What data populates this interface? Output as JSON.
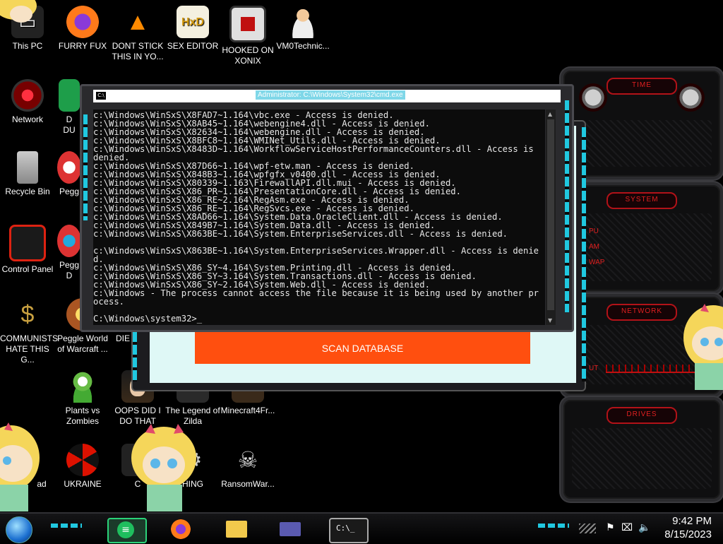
{
  "desktop": {
    "icons": [
      {
        "label": "This PC"
      },
      {
        "label": "FURRY FUX"
      },
      {
        "label": "DONT STICK\nTHIS IN YO..."
      },
      {
        "label": "SEX EDITOR"
      },
      {
        "label": "HOOKED ON\nXONIX"
      },
      {
        "label": "VM0Technic..."
      },
      {
        "label": "Network"
      },
      {
        "label": "D\nDU"
      },
      {
        "label": "Recycle Bin"
      },
      {
        "label": "Pegg"
      },
      {
        "label": "Control Panel"
      },
      {
        "label": "Pegg\nD"
      },
      {
        "label": "COMMUNISTS\nHATE THIS G..."
      },
      {
        "label": "Peggle World\nof Warcraft ..."
      },
      {
        "label": "DIE"
      },
      {
        "label": "Plants vs\nZombies"
      },
      {
        "label": "OOPS DID I\nDO THAT"
      },
      {
        "label": "The Legend of\nZilda"
      },
      {
        "label": "Minecraft4Fr..."
      },
      {
        "label": "ad"
      },
      {
        "label": "UKRAINE"
      },
      {
        "label": "C"
      },
      {
        "label": "HING"
      },
      {
        "label": "RansomWar..."
      }
    ]
  },
  "hud": {
    "panels": [
      {
        "title": "TIME"
      },
      {
        "title": "SYSTEM"
      },
      {
        "title": "NETWORK"
      },
      {
        "title": "DRIVES"
      }
    ],
    "system_labels": [
      "PU",
      "AM",
      "WAP"
    ],
    "network_label": "UT"
  },
  "app_window": {
    "scan_button": "SCAN DATABASE"
  },
  "cmd": {
    "title": "Administrator: C:\\Windows\\System32\\cmd.exe",
    "icon_label": "C:\\",
    "output": "c:\\Windows\\WinSxS\\X8FAD7~1.164\\vbc.exe - Access is denied.\nc:\\Windows\\WinSxS\\X8AB45~1.164\\webengine4.dll - Access is denied.\nc:\\Windows\\WinSxS\\X82634~1.164\\webengine.dll - Access is denied.\nc:\\Windows\\WinSxS\\X8BFC8~1.164\\WMINet_Utils.dll - Access is denied.\nc:\\Windows\\WinSxS\\X8483D~1.164\\WorkflowServiceHostPerformanceCounters.dll - Access is denied.\nc:\\Windows\\WinSxS\\X87D66~1.164\\wpf-etw.man - Access is denied.\nc:\\Windows\\WinSxS\\X848B3~1.164\\wpfgfx_v0400.dll - Access is denied.\nc:\\Windows\\WinSxS\\X80339~1.163\\FirewallAPI.dll.mui - Access is denied.\nc:\\Windows\\WinSxS\\X86_PR~1.164\\PresentationCore.dll - Access is denied.\nc:\\Windows\\WinSxS\\X86_RE~2.164\\RegAsm.exe - Access is denied.\nc:\\Windows\\WinSxS\\X86_RE~1.164\\RegSvcs.exe - Access is denied.\nc:\\Windows\\WinSxS\\X8AD66~1.164\\System.Data.OracleClient.dll - Access is denied.\nc:\\Windows\\WinSxS\\X849B7~1.164\\System.Data.dll - Access is denied.\nc:\\Windows\\WinSxS\\X863BE~1.164\\System.EnterpriseServices.dll - Access is denied.\n\nc:\\Windows\\WinSxS\\X863BE~1.164\\System.EnterpriseServices.Wrapper.dll - Access is denied.\nc:\\Windows\\WinSxS\\X86_SY~4.164\\System.Printing.dll - Access is denied.\nc:\\Windows\\WinSxS\\X86_SY~3.164\\System.Transactions.dll - Access is denied.\nc:\\Windows\\WinSxS\\X86_SY~2.164\\System.Web.dll - Access is denied.\nc:\\Windows - The process cannot access the file because it is being used by another process.\n\nC:\\Windows\\system32>_"
  },
  "taskbar": {
    "time": "9:42 PM",
    "date": "8/15/2023",
    "cmd_label": "C:\\_"
  },
  "colors": {
    "accent_cyan": "#20c8e0",
    "hud_red": "#e02020",
    "scan_orange": "#ff4f0f"
  }
}
